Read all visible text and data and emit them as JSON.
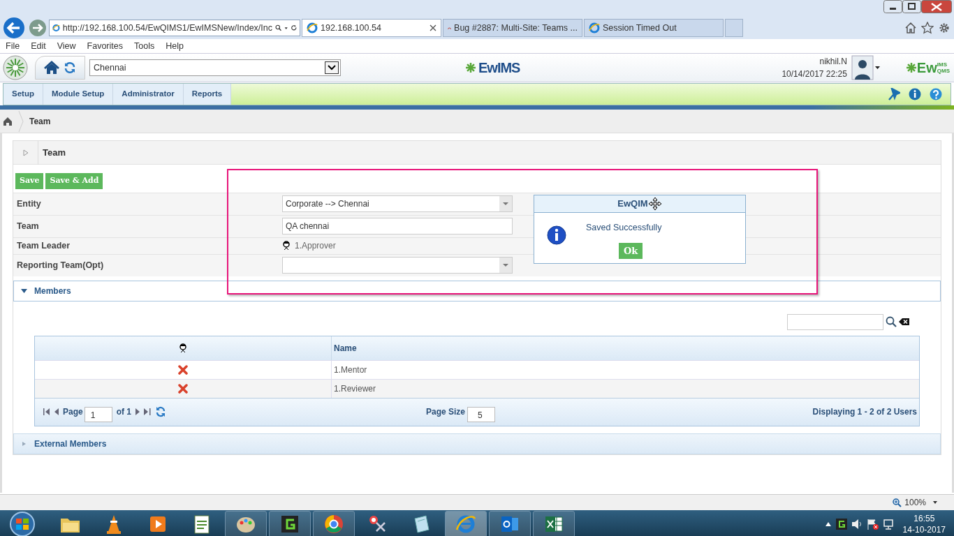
{
  "browser": {
    "address": "http://192.168.100.54/EwQIMS1/EwIMSNew/Index/Inc",
    "tabs": [
      {
        "label": "192.168.100.54",
        "selected": true,
        "kind": "ie"
      },
      {
        "label": "Bug #2887: Multi-Site: Teams ...",
        "selected": false,
        "kind": "bug"
      },
      {
        "label": "Session Timed Out",
        "selected": false,
        "kind": "ie"
      }
    ],
    "menu": [
      "File",
      "Edit",
      "View",
      "Favorites",
      "Tools",
      "Help"
    ]
  },
  "header": {
    "location": "Chennai",
    "logo": "EwIMS",
    "user": "nikhil.N",
    "datetime": "10/14/2017 22:25",
    "brand": {
      "main": "Ew",
      "top": "IMS",
      "bottom": "QMS"
    }
  },
  "nav": [
    "Setup",
    "Module Setup",
    "Administrator",
    "Reports"
  ],
  "breadcrumb": "Team",
  "panel": {
    "title": "Team",
    "buttons": [
      "Save",
      "Save & Add"
    ],
    "fields": [
      {
        "label": "Entity",
        "kind": "select",
        "value": "Corporate --> Chennai"
      },
      {
        "label": "Team",
        "kind": "input",
        "value": "QA chennai"
      },
      {
        "label": "Team Leader",
        "kind": "person",
        "value": "1.Approver"
      },
      {
        "label": "Reporting Team(Opt)",
        "kind": "select"
      }
    ]
  },
  "dialog": {
    "title": "EwQIM",
    "message": "Saved Successfully",
    "button": "Ok"
  },
  "members": {
    "title": "Members",
    "expanded": true,
    "columns": [
      "Name"
    ],
    "rows": [
      {
        "name": "1.Mentor"
      },
      {
        "name": "1.Reviewer"
      }
    ],
    "pager": {
      "page_label": "Page",
      "page": "1",
      "of": "of 1",
      "size_label": "Page Size",
      "size": "5",
      "summary": "Displaying 1 - 2 of 2 Users"
    }
  },
  "external": {
    "title": "External Members",
    "expanded": false
  },
  "status_bar": {
    "zoom": "100%"
  },
  "taskbar": {
    "items": [
      {
        "kind": "folder",
        "open": false,
        "selected": false
      },
      {
        "kind": "cone",
        "open": false,
        "selected": false
      },
      {
        "kind": "play",
        "open": false,
        "selected": false
      },
      {
        "kind": "document",
        "open": false,
        "selected": false
      },
      {
        "kind": "palette",
        "open": true,
        "selected": false
      },
      {
        "kind": "app",
        "open": true,
        "selected": false
      },
      {
        "kind": "circle",
        "open": true,
        "selected": false
      },
      {
        "kind": "scissors",
        "open": false,
        "selected": false
      },
      {
        "kind": "notebook",
        "open": false,
        "selected": false
      },
      {
        "kind": "e",
        "open": true,
        "selected": true
      },
      {
        "kind": "mail",
        "open": true,
        "selected": false
      },
      {
        "kind": "spreadsheet",
        "open": true,
        "selected": false
      }
    ],
    "time": "16:55",
    "date": "14-10-2017"
  }
}
